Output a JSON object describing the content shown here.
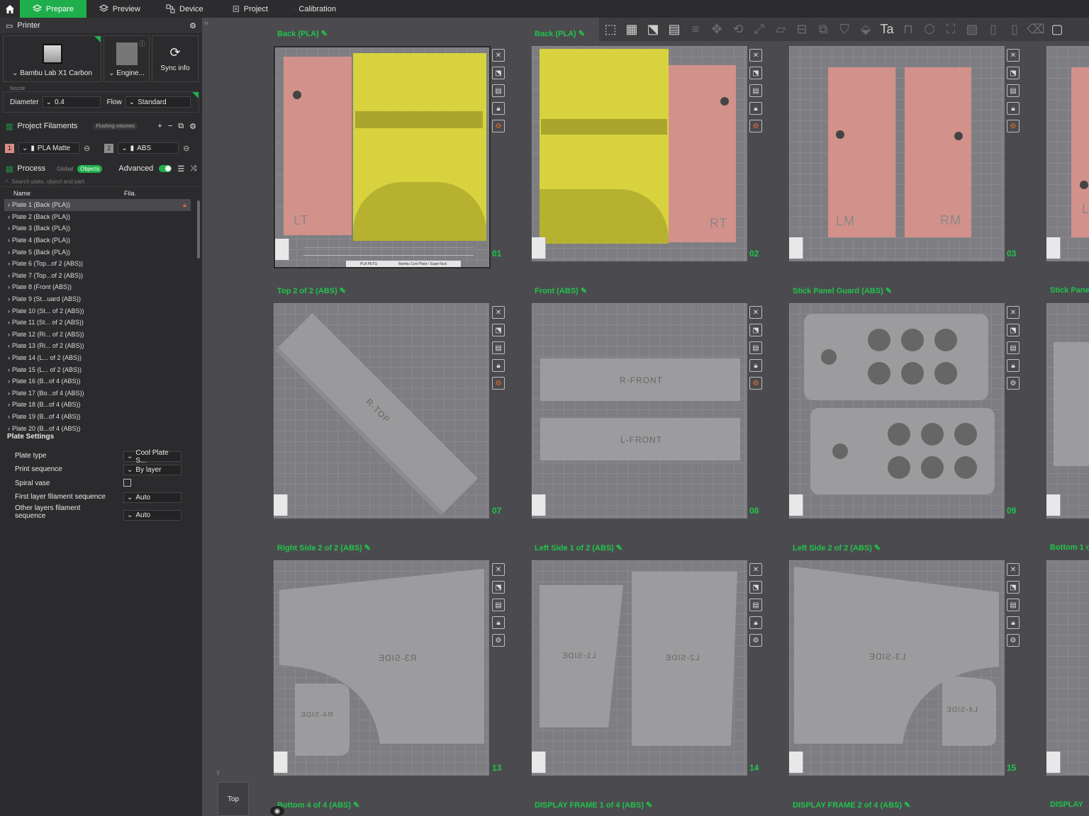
{
  "tabs": [
    {
      "label": "Prepare",
      "active": true
    },
    {
      "label": "Preview"
    },
    {
      "label": "Device"
    },
    {
      "label": "Project"
    },
    {
      "label": "Calibration"
    }
  ],
  "printer": {
    "section_title": "Printer",
    "model": "Bambu Lab X1 Carbon",
    "engine": "Engine...",
    "sync": "Sync info",
    "nozzle_label": "Nozzle",
    "diameter_label": "Diameter",
    "diameter_value": "0.4",
    "flow_label": "Flow",
    "flow_value": "Standard"
  },
  "filaments": {
    "title": "Project Filaments",
    "flushing": "Flushing volumes",
    "items": [
      {
        "num": "1",
        "name": "PLA Matte",
        "color": "#d98b84"
      },
      {
        "num": "2",
        "name": "ABS",
        "color": "#8e8e8e"
      }
    ]
  },
  "process": {
    "title": "Process",
    "global": "Global",
    "objects": "Objects",
    "advanced": "Advanced",
    "search_placeholder": "Search plate, object and part.",
    "col_name": "Name",
    "col_fila": "Fila."
  },
  "plate_list": [
    "Plate 1 (Back (PLA))",
    "Plate 2 (Back (PLA))",
    "Plate 3 (Back (PLA))",
    "Plate 4 (Back (PLA))",
    "Plate 5 (Back (PLA))",
    "Plate 6 (Top...of 2 (ABS))",
    "Plate 7 (Top...of 2 (ABS))",
    "Plate 8 (Front (ABS))",
    "Plate 9 (St...uard (ABS))",
    "Plate 10 (St... of 2 (ABS))",
    "Plate 11 (St... of 2 (ABS))",
    "Plate 12 (Ri... of 2 (ABS))",
    "Plate 13 (Ri... of 2 (ABS))",
    "Plate 14 (L... of 2 (ABS))",
    "Plate 15 (L... of 2 (ABS))",
    "Plate 16 (B...of 4 (ABS))",
    "Plate 17 (Bo...of 4 (ABS))",
    "Plate 18 (B...of 4 (ABS))",
    "Plate 19 (B...of 4 (ABS))",
    "Plate 20 (B...of 4 (ABS))"
  ],
  "plate_settings": {
    "title": "Plate Settings",
    "rows": [
      {
        "label": "Plate type",
        "value": "Cool Plate S..."
      },
      {
        "label": "Print sequence",
        "value": "By layer"
      },
      {
        "label": "Spiral vase",
        "value": ""
      },
      {
        "label": "First layer filament sequence",
        "value": "Auto"
      },
      {
        "label": "Other layers filament sequence",
        "value": "Auto"
      }
    ]
  },
  "plates": [
    {
      "title": "Back (PLA)",
      "num": "01"
    },
    {
      "title": "Back (PLA)",
      "num": "02"
    },
    {
      "title": "",
      "num": "03"
    },
    {
      "title": "Top 2 of 2 (ABS)",
      "num": "07"
    },
    {
      "title": "Front (ABS)",
      "num": "08"
    },
    {
      "title": "Stick Panel Guard (ABS)",
      "num": "09"
    },
    {
      "title": "Stick Pane",
      "num": ""
    },
    {
      "title": "Right Side 2 of 2 (ABS)",
      "num": "13"
    },
    {
      "title": "Left Side 1 of 2 (ABS)",
      "num": "14"
    },
    {
      "title": "Left Side 2 of 2 (ABS)",
      "num": "15"
    },
    {
      "title": "Bottom 1 o",
      "num": ""
    },
    {
      "title": "Bottom 4 of 4 (ABS)",
      "num": ""
    },
    {
      "title": "DISPLAY FRAME 1 of 4 (ABS)",
      "num": ""
    },
    {
      "title": "DISPLAY FRAME 2 of 4 (ABS)",
      "num": ""
    },
    {
      "title": "DISPLAY",
      "num": ""
    }
  ],
  "part_labels": {
    "lt": "LT",
    "rt": "RT",
    "lm": "LM",
    "rm": "RM",
    "l_partial": "L",
    "rtop": "R-TOP",
    "rfront": "R-FRONT",
    "lfront": "L-FRONT",
    "r3": "R3-SIDE",
    "r4": "R4-SIDE",
    "l1": "L1-SIDE",
    "l2": "L2-SIDE",
    "l3": "L3-SIDE",
    "l4": "L4-SIDE"
  },
  "plate_bar": {
    "plate1": "PLA PETG",
    "plate1_note": "Bambu Cool Plate / SuperTack"
  },
  "view": {
    "top": "Top",
    "axis_y": "Y"
  }
}
